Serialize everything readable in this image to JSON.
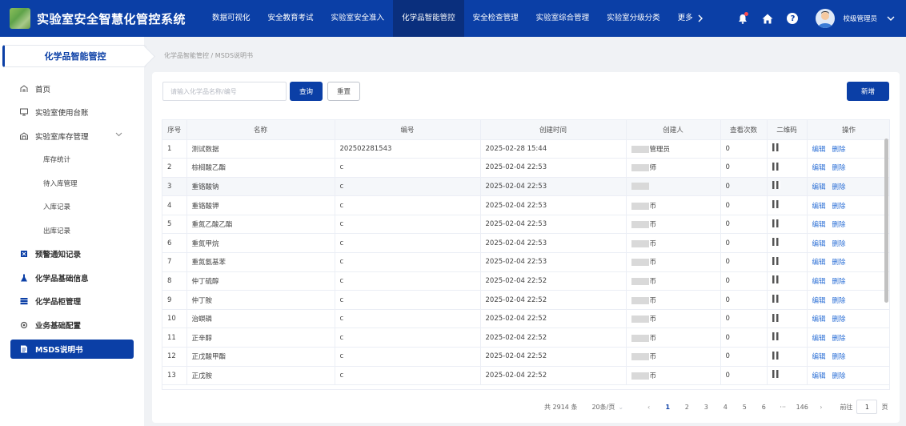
{
  "app": {
    "title": "实验室安全智慧化管控系统"
  },
  "nav": {
    "items": [
      "数据可视化",
      "安全教育考试",
      "实验室安全准入",
      "化学品智能管控",
      "安全检查管理",
      "实验室综合管理",
      "实验室分级分类"
    ],
    "more": "更多",
    "active_index": 3
  },
  "user": {
    "name": "校级管理员"
  },
  "sidebar": {
    "header": "化学品智能管控",
    "items": [
      {
        "label": "首页",
        "icon": "home-icon"
      },
      {
        "label": "实验室使用台账",
        "icon": "monitor-icon"
      },
      {
        "label": "实验室库存管理",
        "icon": "warehouse-icon"
      },
      {
        "label": "库存统计"
      },
      {
        "label": "待入库管理"
      },
      {
        "label": "入库记录"
      },
      {
        "label": "出库记录"
      },
      {
        "label": "预警通知记录",
        "icon": "warning-icon"
      },
      {
        "label": "化学品基础信息",
        "icon": "flask-icon"
      },
      {
        "label": "化学品柜管理",
        "icon": "cabinet-icon"
      },
      {
        "label": "业务基础配置",
        "icon": "gear-icon"
      },
      {
        "label": "MSDS说明书",
        "icon": "document-icon"
      }
    ]
  },
  "breadcrumb": {
    "parent": "化学品智能管控",
    "separator": "/",
    "current": "MSDS说明书"
  },
  "toolbar": {
    "search_placeholder": "请输入化学品名称/编号",
    "query": "查询",
    "reset": "重置",
    "add": "新增"
  },
  "table": {
    "columns": [
      "序号",
      "名称",
      "编号",
      "创建时间",
      "创建人",
      "查看次数",
      "二维码",
      "操作"
    ],
    "edit_label": "编辑",
    "delete_label": "删除",
    "rows": [
      {
        "no": "1",
        "name": "测试数据",
        "code": "202502281543",
        "time": "2025-02-28 15:44",
        "creator": "管理员",
        "views": "0"
      },
      {
        "no": "2",
        "name": "棕榈酸乙酯",
        "code": "c",
        "time": "2025-02-04 22:53",
        "creator": "师",
        "views": "0"
      },
      {
        "no": "3",
        "name": "重铬酸钠",
        "code": "c",
        "time": "2025-02-04 22:53",
        "creator": "",
        "views": "0"
      },
      {
        "no": "4",
        "name": "重铬酸钾",
        "code": "c",
        "time": "2025-02-04 22:53",
        "creator": "币",
        "views": "0"
      },
      {
        "no": "5",
        "name": "重氮乙酸乙酯",
        "code": "c",
        "time": "2025-02-04 22:53",
        "creator": "币",
        "views": "0"
      },
      {
        "no": "6",
        "name": "重氮甲烷",
        "code": "c",
        "time": "2025-02-04 22:53",
        "creator": "币",
        "views": "0"
      },
      {
        "no": "7",
        "name": "重氮氨基苯",
        "code": "c",
        "time": "2025-02-04 22:53",
        "creator": "币",
        "views": "0"
      },
      {
        "no": "8",
        "name": "仲丁硫醇",
        "code": "c",
        "time": "2025-02-04 22:52",
        "creator": "币",
        "views": "0"
      },
      {
        "no": "9",
        "name": "仲丁胺",
        "code": "c",
        "time": "2025-02-04 22:52",
        "creator": "币",
        "views": "0"
      },
      {
        "no": "10",
        "name": "治螟磷",
        "code": "c",
        "time": "2025-02-04 22:52",
        "creator": "币",
        "views": "0"
      },
      {
        "no": "11",
        "name": "正辛醇",
        "code": "c",
        "time": "2025-02-04 22:52",
        "creator": "币",
        "views": "0"
      },
      {
        "no": "12",
        "name": "正戊酸甲酯",
        "code": "c",
        "time": "2025-02-04 22:52",
        "creator": "币",
        "views": "0"
      },
      {
        "no": "13",
        "name": "正戊胺",
        "code": "c",
        "time": "2025-02-04 22:52",
        "creator": "币",
        "views": "0"
      }
    ]
  },
  "pagination": {
    "total": "共 2914 条",
    "page_size": "20条/页",
    "pages": [
      "1",
      "2",
      "3",
      "4",
      "5",
      "6",
      "···",
      "146"
    ],
    "current": "1",
    "goto_label": "前往",
    "goto_value": "1",
    "page_unit": "页"
  },
  "colors": {
    "primary": "#0b3fa6",
    "active_nav": "#0a2f7d",
    "link": "#2b6fd6"
  }
}
